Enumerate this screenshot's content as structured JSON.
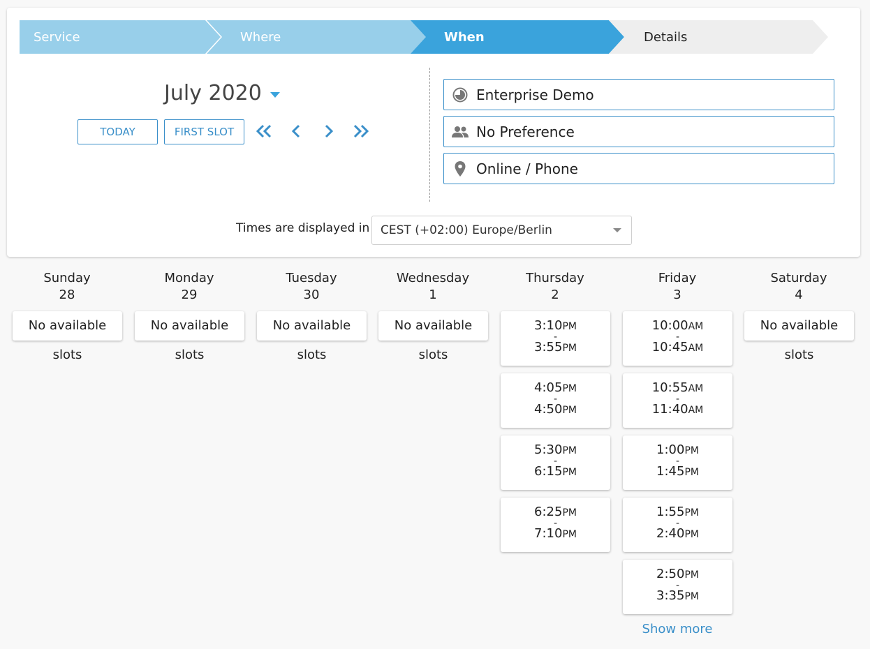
{
  "steps": [
    "Service",
    "Where",
    "When",
    "Details"
  ],
  "calendar": {
    "month_label": "July 2020",
    "today_label": "TODAY",
    "first_slot_label": "FIRST SLOT"
  },
  "filters": {
    "service": "Enterprise Demo",
    "staff": "No Preference",
    "location": "Online / Phone"
  },
  "timezone": {
    "label": "Times are displayed in",
    "value": "CEST (+02:00) Europe/Berlin"
  },
  "no_slots_label": "No available slots",
  "show_more_label": "Show more",
  "colors": {
    "accent": "#3aa3dc",
    "accent_light": "#98cfea",
    "link": "#3a8fc9"
  },
  "days": [
    {
      "name": "Sunday",
      "date": "28",
      "slots": []
    },
    {
      "name": "Monday",
      "date": "29",
      "slots": []
    },
    {
      "name": "Tuesday",
      "date": "30",
      "slots": []
    },
    {
      "name": "Wednesday",
      "date": "1",
      "slots": []
    },
    {
      "name": "Thursday",
      "date": "2",
      "slots": [
        {
          "start": "3:10",
          "start_ampm": "PM",
          "end": "3:55",
          "end_ampm": "PM"
        },
        {
          "start": "4:05",
          "start_ampm": "PM",
          "end": "4:50",
          "end_ampm": "PM"
        },
        {
          "start": "5:30",
          "start_ampm": "PM",
          "end": "6:15",
          "end_ampm": "PM"
        },
        {
          "start": "6:25",
          "start_ampm": "PM",
          "end": "7:10",
          "end_ampm": "PM"
        }
      ]
    },
    {
      "name": "Friday",
      "date": "3",
      "show_more": true,
      "slots": [
        {
          "start": "10:00",
          "start_ampm": "AM",
          "end": "10:45",
          "end_ampm": "AM"
        },
        {
          "start": "10:55",
          "start_ampm": "AM",
          "end": "11:40",
          "end_ampm": "AM"
        },
        {
          "start": "1:00",
          "start_ampm": "PM",
          "end": "1:45",
          "end_ampm": "PM"
        },
        {
          "start": "1:55",
          "start_ampm": "PM",
          "end": "2:40",
          "end_ampm": "PM"
        },
        {
          "start": "2:50",
          "start_ampm": "PM",
          "end": "3:35",
          "end_ampm": "PM"
        }
      ]
    },
    {
      "name": "Saturday",
      "date": "4",
      "slots": []
    }
  ]
}
